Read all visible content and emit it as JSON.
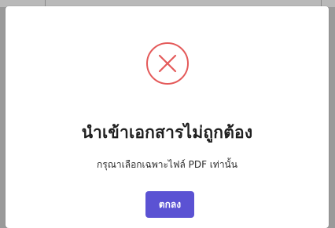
{
  "dialog": {
    "title": "นำเข้าเอกสารไม่ถูกต้อง",
    "message": "กรุณาเลือกเฉพาะไฟล์ PDF เท่านั้น",
    "ok_label": "ตกลง",
    "icon": "close-x-circle-icon"
  },
  "colors": {
    "accent": "#5b52d3",
    "error": "#e45a5a",
    "overlay": "#9a9a9a"
  }
}
